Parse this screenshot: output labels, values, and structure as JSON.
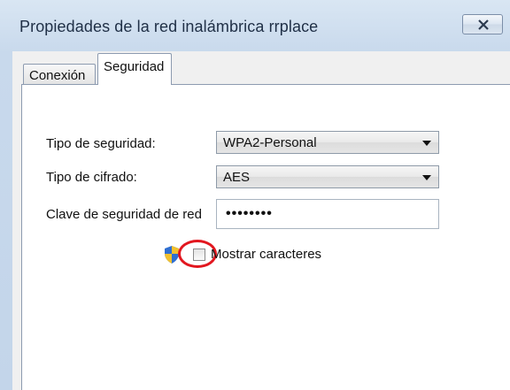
{
  "window": {
    "title": "Propiedades de la red inalámbrica rrplace",
    "close_icon": "close-icon"
  },
  "tabs": [
    {
      "label": "Conexión",
      "active": false
    },
    {
      "label": "Seguridad",
      "active": true
    }
  ],
  "security": {
    "type_label": "Tipo de seguridad:",
    "type_value": "WPA2-Personal",
    "cipher_label": "Tipo de cifrado:",
    "cipher_value": "AES",
    "key_label": "Clave de seguridad de red",
    "key_value": "••••••••",
    "show_chars_label": "Mostrar caracteres",
    "show_chars_checked": false,
    "shield_icon": "uac-shield-icon",
    "highlight_color": "#e2171f"
  }
}
